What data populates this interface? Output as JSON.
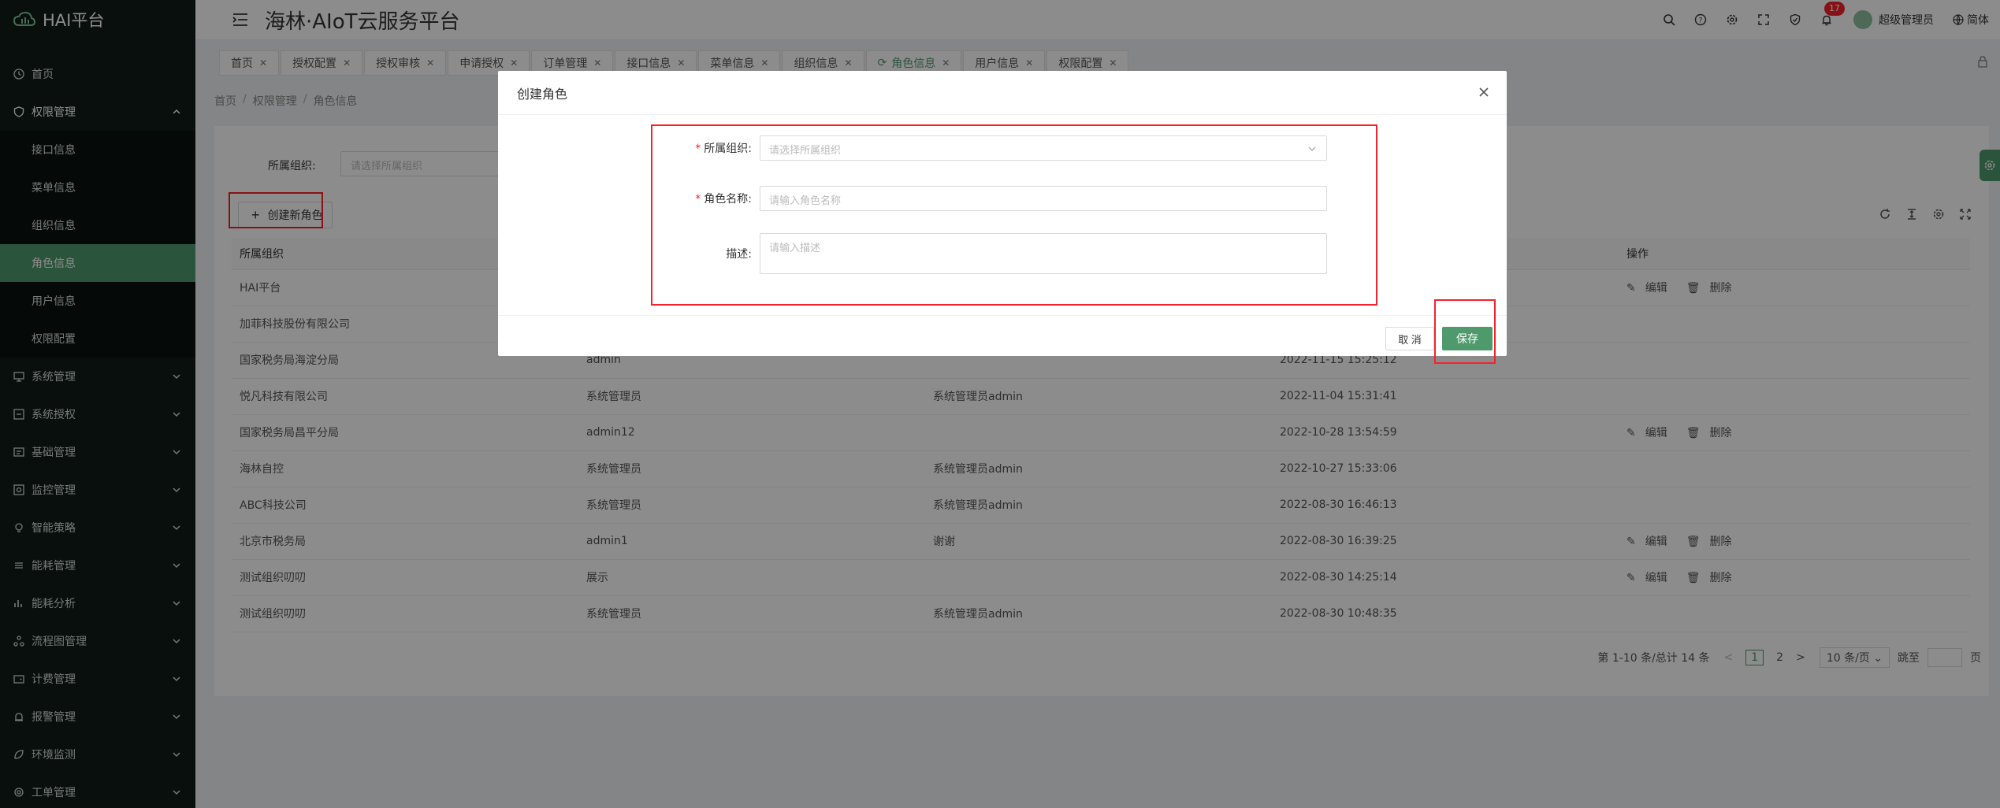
{
  "sidebar": {
    "logo": "HAI平台",
    "items": [
      {
        "label": "首页"
      },
      {
        "label": "权限管理"
      },
      {
        "label": "系统管理"
      },
      {
        "label": "系统授权"
      },
      {
        "label": "基础管理"
      },
      {
        "label": "监控管理"
      },
      {
        "label": "智能策略"
      },
      {
        "label": "能耗管理"
      },
      {
        "label": "能耗分析"
      },
      {
        "label": "流程图管理"
      },
      {
        "label": "计费管理"
      },
      {
        "label": "报警管理"
      },
      {
        "label": "环境监测"
      },
      {
        "label": "工单管理"
      }
    ],
    "submenu": [
      {
        "label": "接口信息"
      },
      {
        "label": "菜单信息"
      },
      {
        "label": "组织信息"
      },
      {
        "label": "角色信息"
      },
      {
        "label": "用户信息"
      },
      {
        "label": "权限配置"
      }
    ]
  },
  "header": {
    "title": "海林·AIoT云服务平台",
    "notification_count": "17",
    "user_name": "超级管理员",
    "language": "简体"
  },
  "tabs": [
    {
      "label": "首页"
    },
    {
      "label": "授权配置"
    },
    {
      "label": "授权审核"
    },
    {
      "label": "申请授权"
    },
    {
      "label": "订单管理"
    },
    {
      "label": "接口信息"
    },
    {
      "label": "菜单信息"
    },
    {
      "label": "组织信息"
    },
    {
      "label": "角色信息"
    },
    {
      "label": "用户信息"
    },
    {
      "label": "权限配置"
    }
  ],
  "breadcrumb": [
    "首页",
    "权限管理",
    "角色信息"
  ],
  "filter": {
    "label": "所属组织:",
    "placeholder": "请选择所属组织"
  },
  "create_button": "创建新角色",
  "table": {
    "headers": [
      "所属组织",
      "",
      "",
      "",
      "操作"
    ],
    "rows": [
      {
        "org": "HAI平台",
        "name": "",
        "desc": "",
        "time": "",
        "ops": true
      },
      {
        "org": "加菲科技股份有限公司",
        "name": "",
        "desc": "",
        "time": "",
        "ops": false
      },
      {
        "org": "国家税务局海淀分局",
        "name": "admin",
        "desc": "",
        "time": "2022-11-15 15:25:12",
        "ops": false
      },
      {
        "org": "悦凡科技有限公司",
        "name": "系统管理员",
        "desc": "系统管理员admin",
        "time": "2022-11-04 15:31:41",
        "ops": false
      },
      {
        "org": "国家税务局昌平分局",
        "name": "admin12",
        "desc": "",
        "time": "2022-10-28 13:54:59",
        "ops": true
      },
      {
        "org": "海林自控",
        "name": "系统管理员",
        "desc": "系统管理员admin",
        "time": "2022-10-27 15:33:06",
        "ops": false
      },
      {
        "org": "ABC科技公司",
        "name": "系统管理员",
        "desc": "系统管理员admin",
        "time": "2022-08-30 16:46:13",
        "ops": false
      },
      {
        "org": "北京市税务局",
        "name": "admin1",
        "desc": "谢谢",
        "time": "2022-08-30 16:39:25",
        "ops": true
      },
      {
        "org": "测试组织叨叨",
        "name": "展示",
        "desc": "",
        "time": "2022-08-30 14:25:14",
        "ops": true
      },
      {
        "org": "测试组织叨叨",
        "name": "系统管理员",
        "desc": "系统管理员admin",
        "time": "2022-08-30 10:48:35",
        "ops": false
      }
    ],
    "edit_label": "编辑",
    "delete_label": "删除"
  },
  "pager": {
    "summary": "第 1-10 条/总计 14 条",
    "prev": "<",
    "page1": "1",
    "page2": "2",
    "next": ">",
    "size": "10 条/页",
    "jump_label": "跳至",
    "page_suffix": "页"
  },
  "modal": {
    "title": "创建角色",
    "org_label": "所属组织:",
    "org_placeholder": "请选择所属组织",
    "name_label": "角色名称:",
    "name_placeholder": "请输入角色名称",
    "desc_label": "描述:",
    "desc_placeholder": "请输入描述",
    "cancel": "取 消",
    "save": "保存"
  },
  "colors": {
    "accent": "#4f9a6d",
    "sidebar_bg": "#101c17",
    "highlight": "#f5222d"
  }
}
